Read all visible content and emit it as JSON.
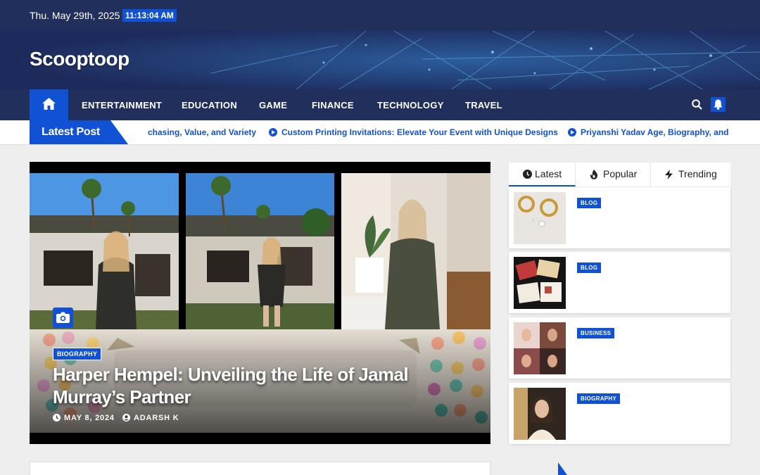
{
  "topbar": {
    "date": "Thu. May 29th, 2025",
    "time": "11:13:04 AM"
  },
  "site": {
    "title": "Scooptoop"
  },
  "nav": {
    "home_icon": "home-icon",
    "items": [
      "ENTERTAINMENT",
      "EDUCATION",
      "GAME",
      "FINANCE",
      "TECHNOLOGY",
      "TRAVEL"
    ],
    "search_icon": "search-icon",
    "bell_icon": "bell-icon"
  },
  "ticker": {
    "label": "Latest Post",
    "items": [
      "chasing, Value, and Variety",
      "Custom Printing Invitations: Elevate Your Event with Unique Designs",
      "Priyanshi Yadav Age, Biography, and N"
    ]
  },
  "featured": {
    "category": "BIOGRAPHY",
    "title": "Harper Hempel: Unveiling the Life of Jamal Murray’s Partner",
    "date": "MAY 8, 2024",
    "author": "ADARSH K",
    "camera_icon": "camera-icon"
  },
  "sidebar": {
    "tabs": [
      {
        "label": "Latest",
        "icon": "clock-icon"
      },
      {
        "label": "Popular",
        "icon": "fire-icon"
      },
      {
        "label": "Trending",
        "icon": "bolt-icon"
      }
    ],
    "posts": [
      {
        "category": "BLOG"
      },
      {
        "category": "BLOG"
      },
      {
        "category": "BUSINESS"
      },
      {
        "category": "BIOGRAPHY"
      }
    ]
  },
  "colors": {
    "navy": "#202f5b",
    "accent": "#1151d3",
    "background": "#eeeeee"
  }
}
